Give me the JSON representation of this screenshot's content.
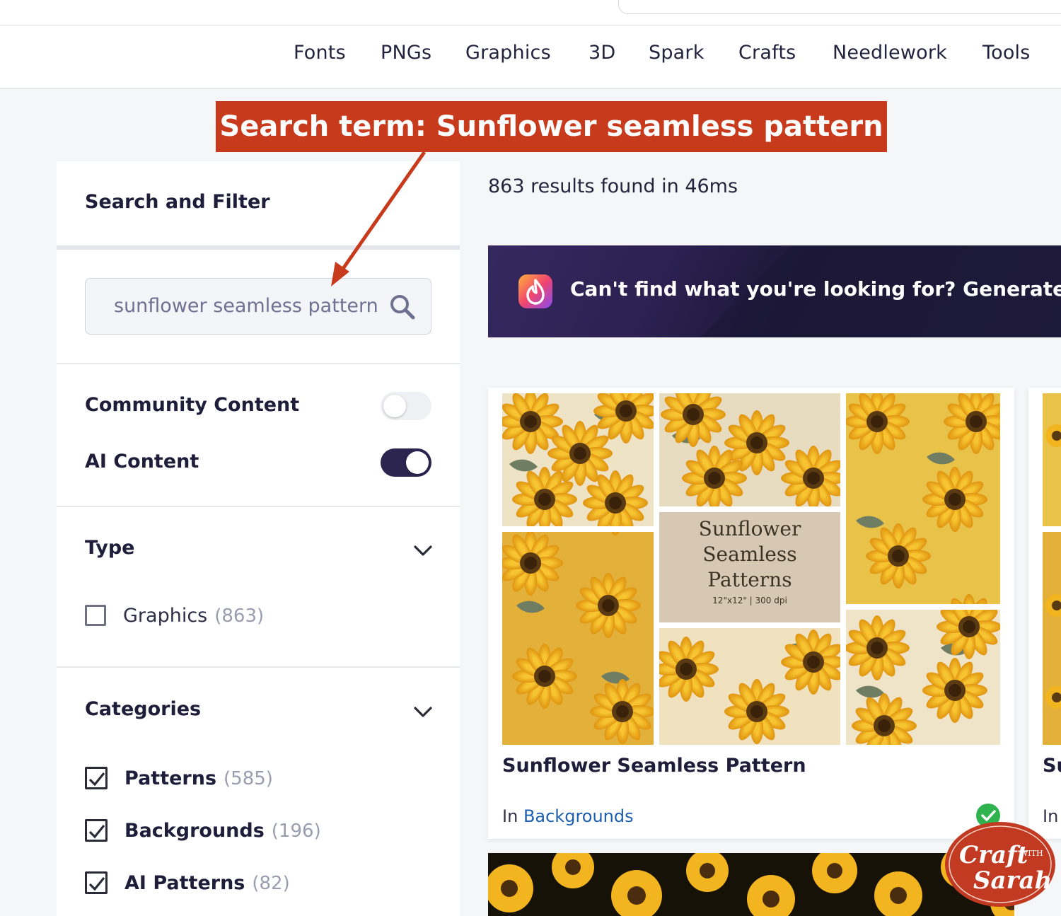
{
  "nav": {
    "items": [
      "Fonts",
      "PNGs",
      "Graphics",
      "3D",
      "Spark",
      "Crafts",
      "Needlework",
      "Tools"
    ]
  },
  "annotation": {
    "text": "Search term: Sunflower seamless pattern"
  },
  "sidebar": {
    "title": "Search and Filter",
    "search": {
      "value": "sunflower seamless pattern",
      "icon": "search-icon"
    },
    "toggles": [
      {
        "label": "Community Content",
        "on": false
      },
      {
        "label": "AI Content",
        "on": true
      }
    ],
    "type": {
      "title": "Type",
      "options": [
        {
          "label": "Graphics",
          "count": "(863)",
          "checked": false
        }
      ]
    },
    "categories": {
      "title": "Categories",
      "options": [
        {
          "label": "Patterns",
          "count": "(585)",
          "checked": true
        },
        {
          "label": "Backgrounds",
          "count": "(196)",
          "checked": true
        },
        {
          "label": "AI Patterns",
          "count": "(82)",
          "checked": true
        }
      ]
    }
  },
  "main": {
    "results": "863 results found in 46ms",
    "banner": {
      "text": "Can't find what you're looking for? Generate your",
      "icon": "spark-logo-icon"
    },
    "cards": [
      {
        "title": "Sunflower Seamless Pattern",
        "category_prefix": "In",
        "category": "Backgrounds",
        "image_text": {
          "line1": "Sunflower",
          "line2": "Seamless",
          "line3": "Patterns",
          "spec": "12\"x12\" | 300 dpi"
        }
      },
      {
        "title": "Su",
        "category_prefix": "In"
      }
    ]
  },
  "watermark": {
    "line1": "Craft",
    "with": "WITH",
    "line2": "Sarah"
  },
  "colors": {
    "annotation": "#c73a1c",
    "toggle_on": "#2b2550",
    "banner": "#2c2152",
    "link": "#1c5fb0",
    "verified": "#2fb34f",
    "sunflower": "#f2b51f"
  }
}
